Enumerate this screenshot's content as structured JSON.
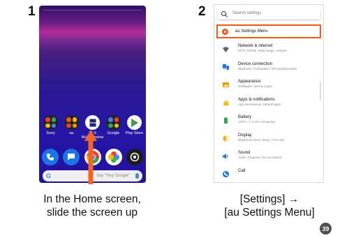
{
  "step1": {
    "number": "1",
    "apps": [
      {
        "label": "Sony",
        "name": "sony"
      },
      {
        "label": "au",
        "name": "au"
      },
      {
        "label": "21:9\nMulti-window",
        "name": "multi-window"
      },
      {
        "label": "Google",
        "name": "google"
      },
      {
        "label": "Play Store",
        "name": "play-store"
      }
    ],
    "dock": [
      "phone-icon",
      "messages-icon",
      "chrome-icon",
      "photos-icon",
      "camera-icon"
    ],
    "search_placeholder": "Say \"Hey Google\"",
    "google_letter": "G",
    "caption_line1": "In the Home screen,",
    "caption_line2": "slide the screen up"
  },
  "step2": {
    "number": "2",
    "search_placeholder": "Search settings",
    "highlighted_item": "au Settings Menu",
    "items": [
      {
        "title": "Network & internet",
        "subtitle": "Wi-Fi, Mobile, Data usage, Hotspot",
        "icon": "wifi-icon",
        "color": "#5f6368"
      },
      {
        "title": "Device connection",
        "subtitle": "Bluetooth, TV/Speaker, NFC/Osaifu-Keitai",
        "icon": "device-icon",
        "color": "#1a73e8"
      },
      {
        "title": "Appearance",
        "subtitle": "Wallpaper, Xperia Loops",
        "icon": "appearance-icon",
        "color": "#f29900"
      },
      {
        "title": "Apps & notifications",
        "subtitle": "App permissions, Default apps",
        "icon": "apps-icon",
        "color": "#fbbc04"
      },
      {
        "title": "Battery",
        "subtitle": "100% - 7 d 15 h remaining",
        "icon": "battery-icon",
        "color": "#34a853"
      },
      {
        "title": "Display",
        "subtitle": "Brightness level, Sleep, Font size",
        "icon": "display-icon",
        "color": "#f9ab00"
      },
      {
        "title": "Sound",
        "subtitle": "Audio, Ringtone, Do not disturb",
        "icon": "sound-icon",
        "color": "#1a73e8"
      },
      {
        "title": "Call",
        "subtitle": "",
        "icon": "call-icon",
        "color": "#1a73e8"
      }
    ],
    "caption_line1": "[Settings] →",
    "caption_line2": "[au Settings Menu]"
  },
  "page_number": "39",
  "colors": {
    "accent": "#f05a1e",
    "arrow": "#f26522"
  }
}
